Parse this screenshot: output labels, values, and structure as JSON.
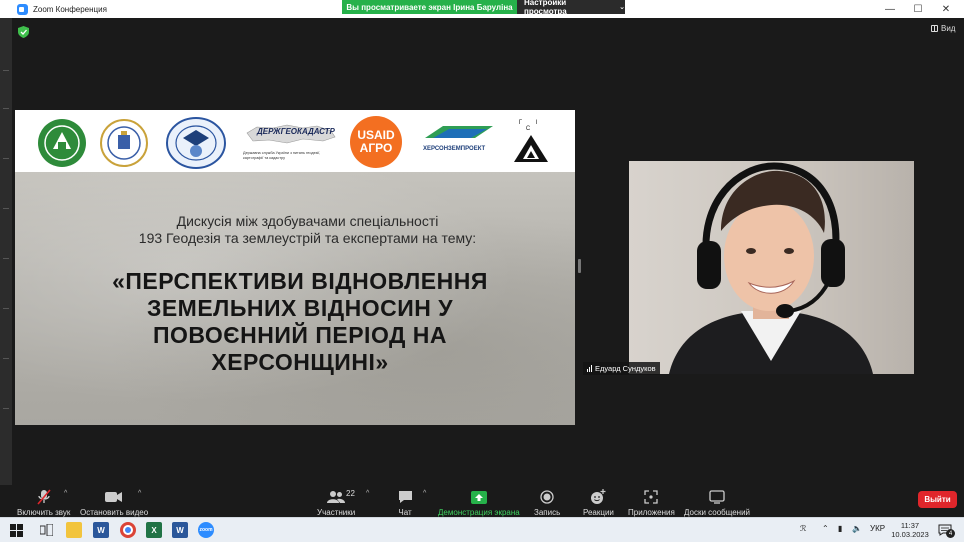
{
  "window": {
    "title": "Zoom Конференция",
    "share_banner": "Вы просматриваете экран Ірина Баруліна",
    "view_settings": "Настройки просмотра",
    "view_button": "Вид"
  },
  "slide": {
    "logos": [
      {
        "name": "university-seal"
      },
      {
        "name": "iiadi-seal"
      },
      {
        "name": "kherson-emblem"
      },
      {
        "name": "derzhgeokadastr",
        "text": "ДЕРЖГЕОКАДАСТР",
        "caption": "Державна служба України з питань геодезії, картографії та кадастру"
      },
      {
        "name": "usaid-agro",
        "line1": "USAID",
        "line2": "АГРО",
        "color": "#f36f21"
      },
      {
        "name": "khersonzemproekt",
        "text": "ХЕРСОНЗЕМПРОЕКТ"
      },
      {
        "name": "gis",
        "text": "Г І С"
      }
    ],
    "subtitle_line1": "Дискусія між здобувачами спеціальності",
    "subtitle_line2": "193 Геодезія та землеустрій та експертами на тему:",
    "title_line1": "«ПЕРСПЕКТИВИ ВІДНОВЛЕННЯ",
    "title_line2": "ЗЕМЕЛЬНИХ ВІДНОСИН У",
    "title_line3": "ПОВОЄННИЙ ПЕРІОД НА",
    "title_line4": "ХЕРСОНЩИНІ»"
  },
  "participant": {
    "name": "Едуард Сундуков"
  },
  "toolbar": {
    "mute": "Включить звук",
    "video": "Остановить видео",
    "participants": "Участники",
    "participants_count": "22",
    "chat": "Чат",
    "share": "Демонстрация экрана",
    "record": "Запись",
    "reactions": "Реакции",
    "apps": "Приложения",
    "whiteboards": "Доски сообщений",
    "leave": "Выйти"
  },
  "taskbar": {
    "lang": "УКР",
    "time": "11:37",
    "date": "10.03.2023",
    "notifications": "4"
  },
  "colors": {
    "share_green": "#26b14a",
    "leave_red": "#e0262b",
    "zoom_blue": "#2d8cff"
  }
}
